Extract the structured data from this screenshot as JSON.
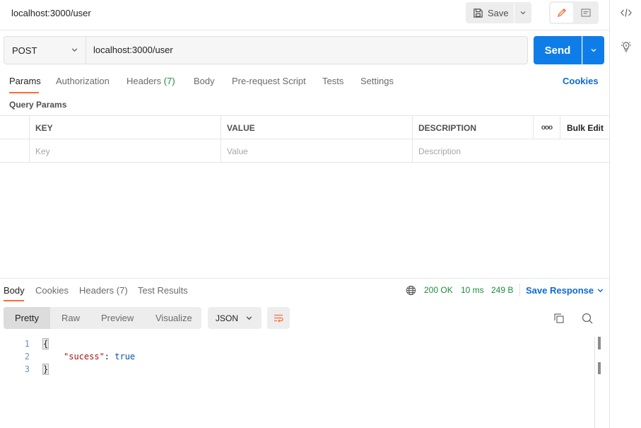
{
  "request": {
    "title": "localhost:3000/user",
    "save_label": "Save",
    "method": "POST",
    "url": "localhost:3000/user",
    "send_label": "Send"
  },
  "request_tabs": [
    {
      "label": "Params",
      "active": true
    },
    {
      "label": "Authorization"
    },
    {
      "label": "Headers",
      "count": "(7)"
    },
    {
      "label": "Body"
    },
    {
      "label": "Pre-request Script"
    },
    {
      "label": "Tests"
    },
    {
      "label": "Settings"
    }
  ],
  "cookies_label": "Cookies",
  "query_params": {
    "title": "Query Params",
    "columns": [
      "KEY",
      "VALUE",
      "DESCRIPTION"
    ],
    "more_label": "ooo",
    "bulk_edit_label": "Bulk Edit",
    "placeholders": [
      "Key",
      "Value",
      "Description"
    ]
  },
  "response": {
    "tabs": [
      {
        "label": "Body",
        "active": true
      },
      {
        "label": "Cookies"
      },
      {
        "label": "Headers",
        "count": "(7)"
      },
      {
        "label": "Test Results"
      }
    ],
    "status": "200 OK",
    "time": "10 ms",
    "size": "249 B",
    "save_response_label": "Save Response",
    "views": [
      "Pretty",
      "Raw",
      "Preview",
      "Visualize"
    ],
    "format": "JSON",
    "lines": [
      {
        "n": "1",
        "text": "{"
      },
      {
        "n": "2",
        "key": "\"sucess\"",
        "sep": ": ",
        "value": "true"
      },
      {
        "n": "3",
        "text": "}"
      }
    ]
  },
  "colors": {
    "accent": "#ff6c37",
    "send": "#0f7de8",
    "link": "#0f6ad0",
    "status_ok": "#1b8c3c"
  }
}
